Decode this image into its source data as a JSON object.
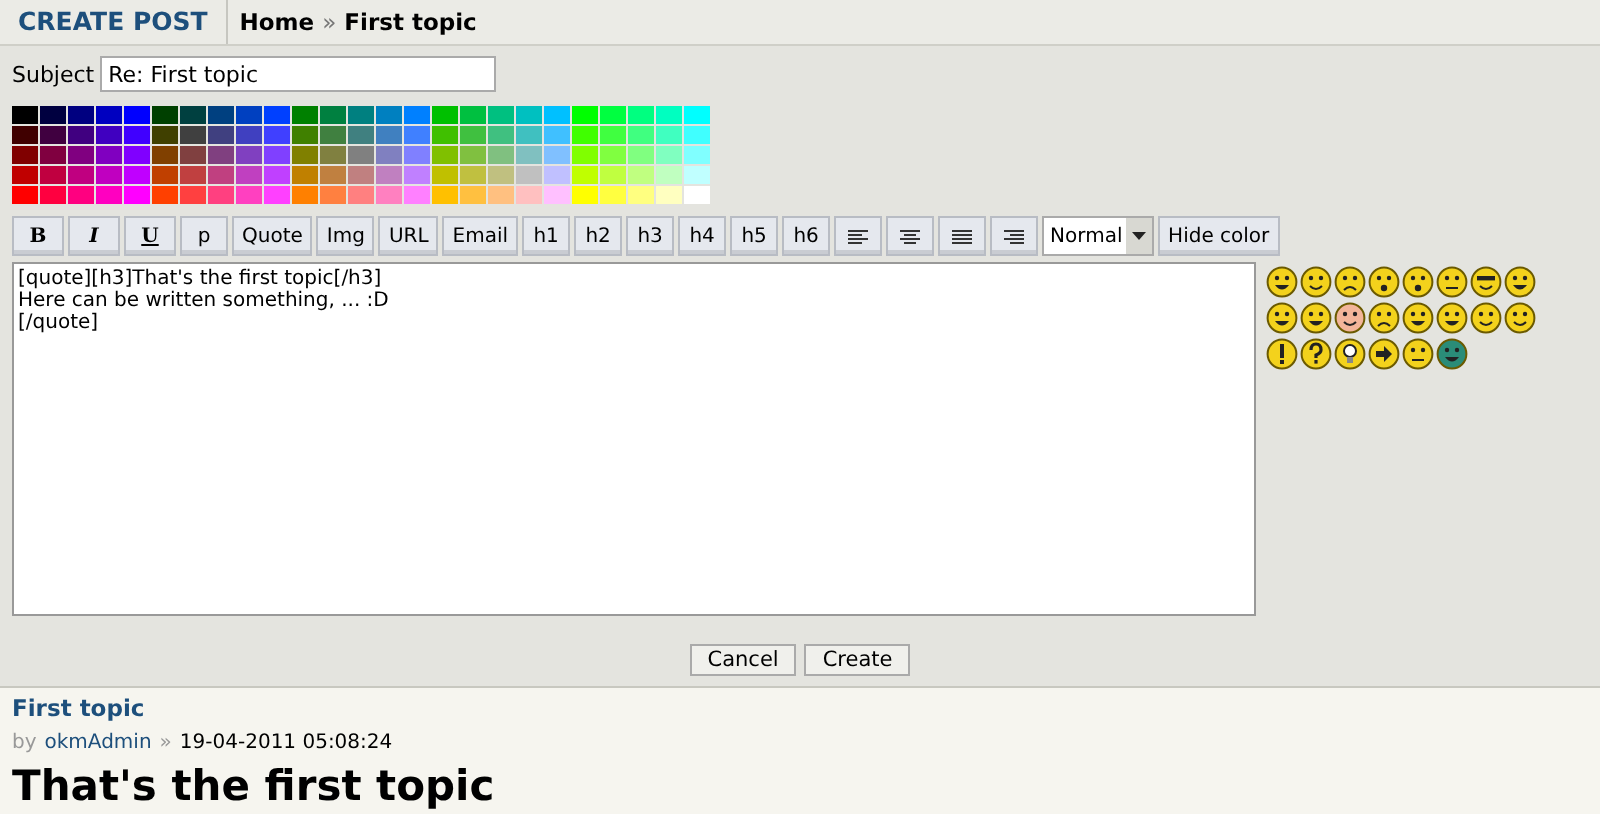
{
  "header": {
    "title": "CREATE POST",
    "breadcrumb": [
      {
        "label": "Home"
      },
      {
        "label": "First topic"
      }
    ],
    "separator": "»"
  },
  "subject": {
    "label": "Subject",
    "value": "Re: First topic"
  },
  "toolbar": [
    {
      "kind": "bold",
      "label": "B"
    },
    {
      "kind": "italic",
      "label": "I"
    },
    {
      "kind": "underline",
      "label": "U"
    },
    {
      "kind": "text",
      "label": "p"
    },
    {
      "kind": "text",
      "label": "Quote"
    },
    {
      "kind": "text",
      "label": "Img"
    },
    {
      "kind": "text",
      "label": "URL"
    },
    {
      "kind": "text",
      "label": "Email"
    },
    {
      "kind": "text",
      "label": "h1"
    },
    {
      "kind": "text",
      "label": "h2"
    },
    {
      "kind": "text",
      "label": "h3"
    },
    {
      "kind": "text",
      "label": "h4"
    },
    {
      "kind": "text",
      "label": "h5"
    },
    {
      "kind": "text",
      "label": "h6"
    },
    {
      "kind": "alignleft"
    },
    {
      "kind": "aligncenter"
    },
    {
      "kind": "alignjustify"
    },
    {
      "kind": "alignright"
    },
    {
      "kind": "select",
      "value": "Normal"
    },
    {
      "kind": "text",
      "label": "Hide color"
    }
  ],
  "message": {
    "value": "[quote][h3]That's the first topic[/h3]\nHere can be written something, ... :D\n[/quote]"
  },
  "smileys": [
    {
      "kind": "grin"
    },
    {
      "kind": "smile"
    },
    {
      "kind": "sad"
    },
    {
      "kind": "surprised"
    },
    {
      "kind": "shock"
    },
    {
      "kind": "confused"
    },
    {
      "kind": "cool"
    },
    {
      "kind": "laugh"
    },
    {
      "kind": "mad"
    },
    {
      "kind": "razz"
    },
    {
      "kind": "blush"
    },
    {
      "kind": "cry"
    },
    {
      "kind": "evil"
    },
    {
      "kind": "twisted"
    },
    {
      "kind": "rolleyes"
    },
    {
      "kind": "wink"
    },
    {
      "kind": "exclaim"
    },
    {
      "kind": "question"
    },
    {
      "kind": "idea"
    },
    {
      "kind": "arrow"
    },
    {
      "kind": "neutral"
    },
    {
      "kind": "green"
    }
  ],
  "actions": [
    {
      "label": "Cancel"
    },
    {
      "label": "Create"
    }
  ],
  "post": {
    "title": "First topic",
    "by": "by",
    "author": "okmAdmin",
    "separator": "»",
    "date": "19-04-2011 05:08:24",
    "heading": "That's the first topic"
  }
}
